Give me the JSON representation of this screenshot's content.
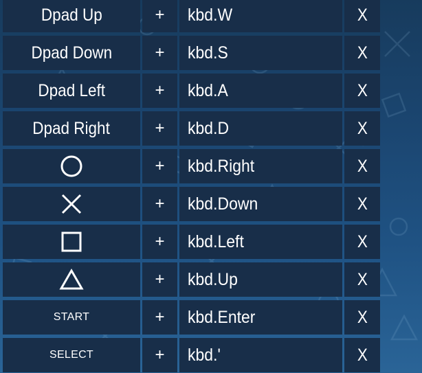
{
  "rows": [
    {
      "button_label": "Dpad Up",
      "button_icon": null,
      "plus": "+",
      "key": "kbd.W",
      "remove": "X"
    },
    {
      "button_label": "Dpad Down",
      "button_icon": null,
      "plus": "+",
      "key": "kbd.S",
      "remove": "X"
    },
    {
      "button_label": "Dpad Left",
      "button_icon": null,
      "plus": "+",
      "key": "kbd.A",
      "remove": "X"
    },
    {
      "button_label": "Dpad Right",
      "button_icon": null,
      "plus": "+",
      "key": "kbd.D",
      "remove": "X"
    },
    {
      "button_label": null,
      "button_icon": "circle-icon",
      "plus": "+",
      "key": "kbd.Right",
      "remove": "X"
    },
    {
      "button_label": null,
      "button_icon": "cross-icon",
      "plus": "+",
      "key": "kbd.Down",
      "remove": "X"
    },
    {
      "button_label": null,
      "button_icon": "square-icon",
      "plus": "+",
      "key": "kbd.Left",
      "remove": "X"
    },
    {
      "button_label": null,
      "button_icon": "triangle-icon",
      "plus": "+",
      "key": "kbd.Up",
      "remove": "X"
    },
    {
      "button_label": "START",
      "button_icon": null,
      "plus": "+",
      "key": "kbd.Enter",
      "remove": "X"
    },
    {
      "button_label": "SELECT",
      "button_icon": null,
      "plus": "+",
      "key": "kbd.'",
      "remove": "X"
    }
  ],
  "colors": {
    "cell_background": "#182e49",
    "text": "#ffffff",
    "background_top": "#173b5d",
    "background_bottom": "#2a6497"
  }
}
